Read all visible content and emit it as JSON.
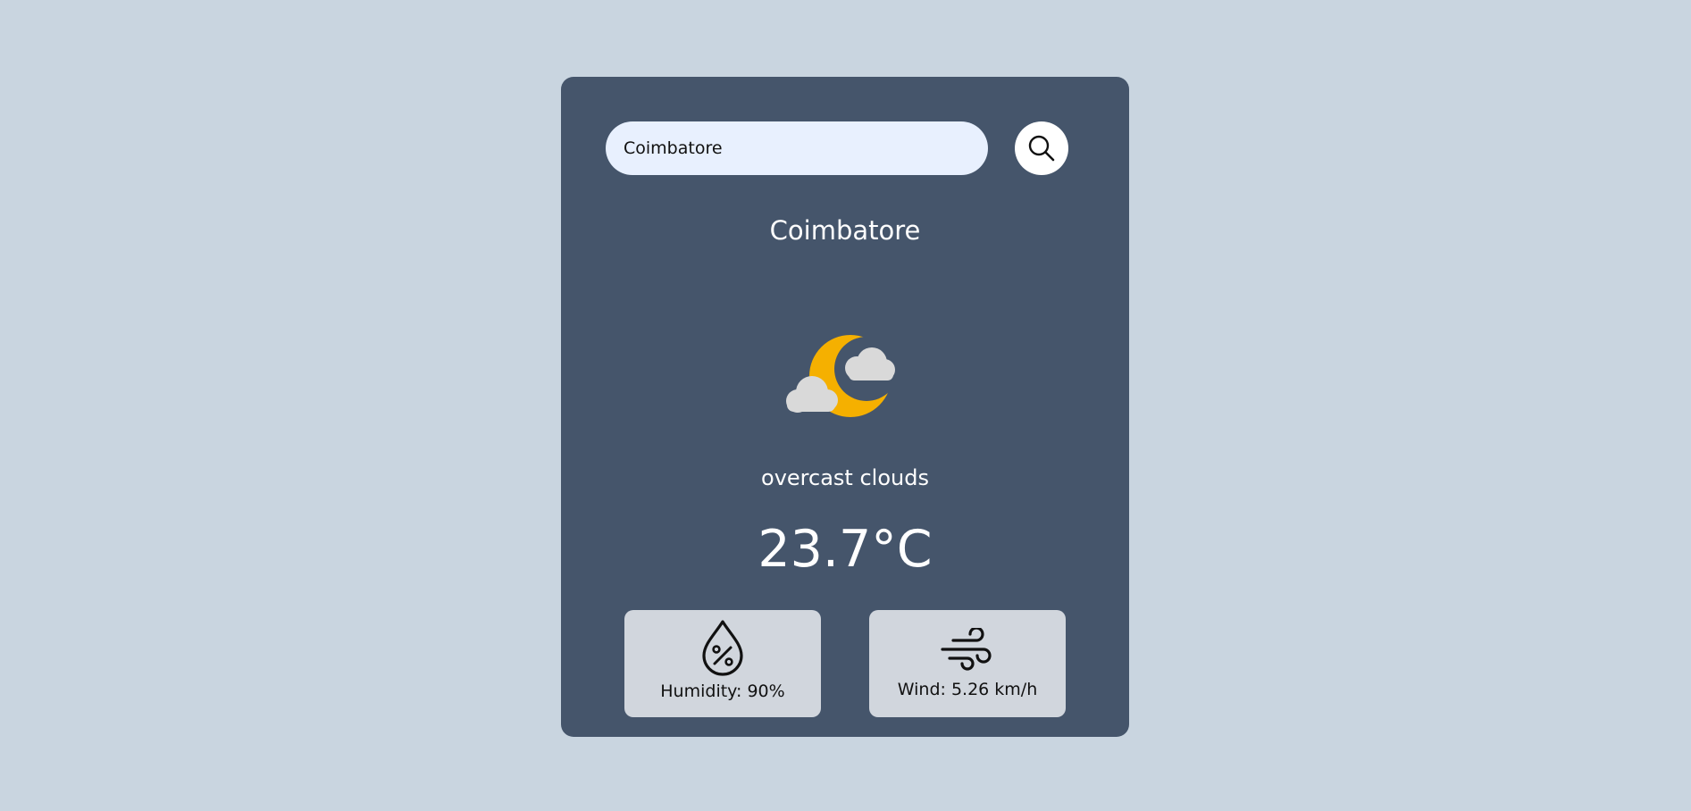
{
  "search": {
    "value": "Coimbatore",
    "icon": "search-icon"
  },
  "location": {
    "city": "Coimbatore"
  },
  "weather": {
    "icon": "moon-clouds-icon",
    "description": "overcast clouds",
    "temperature": "23.7°C"
  },
  "stats": {
    "humidity": {
      "icon": "humidity-drop-icon",
      "label": "Humidity: 90%"
    },
    "wind": {
      "icon": "wind-icon",
      "label": "Wind: 5.26 km/h"
    }
  },
  "colors": {
    "page_background": "#c9d5e0",
    "card_background": "#45556b",
    "input_background": "#e8f0fe",
    "stat_background": "#d1d6dd",
    "moon": "#f5b000",
    "cloud": "#d9d9d9"
  }
}
